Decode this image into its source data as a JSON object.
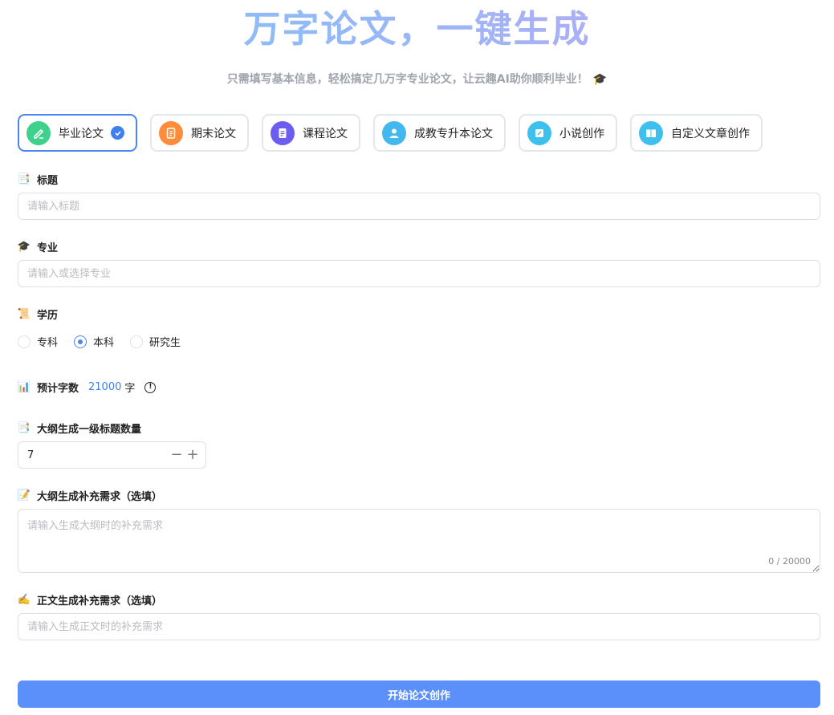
{
  "hero": {
    "title": "万字论文，一键生成",
    "subtitle": "只需填写基本信息，轻松搞定几万字专业论文，让云趣AI助你顺利毕业！",
    "subtitle_emoji": "🎓"
  },
  "paper_types": [
    {
      "label": "毕业论文",
      "icon": "pen-icon",
      "color": "#3fd08c",
      "active": true
    },
    {
      "label": "期末论文",
      "icon": "document-icon",
      "color": "#ff8c3b",
      "active": false
    },
    {
      "label": "课程论文",
      "icon": "notes-icon",
      "color": "#6c5cf0",
      "active": false
    },
    {
      "label": "成教专升本论文",
      "icon": "person-icon",
      "color": "#42b8ef",
      "active": false
    },
    {
      "label": "小说创作",
      "icon": "edit-icon",
      "color": "#3ec0ef",
      "active": false
    },
    {
      "label": "自定义文章创作",
      "icon": "book-icon",
      "color": "#3ec0ef",
      "active": false
    }
  ],
  "form": {
    "title": {
      "label": "标题",
      "placeholder": "请输入标题",
      "emoji": "📑"
    },
    "major": {
      "label": "专业",
      "placeholder": "请输入或选择专业",
      "emoji": "🎓"
    },
    "degree": {
      "label": "学历",
      "emoji": "📜",
      "options": [
        "专科",
        "本科",
        "研究生"
      ],
      "selected": "本科"
    },
    "word_count": {
      "label": "预计字数",
      "value": "21000",
      "unit": "字",
      "emoji": "📊",
      "info": "!"
    },
    "outline_count": {
      "label": "大纲生成一级标题数量",
      "value": "7",
      "emoji": "📑"
    },
    "outline_extra": {
      "label": "大纲生成补充需求（选填）",
      "placeholder": "请输入生成大纲时的补充需求",
      "counter": "0 / 20000",
      "emoji": "📝"
    },
    "body_extra": {
      "label": "正文生成补充需求（选填）",
      "placeholder": "请输入生成正文时的补充需求",
      "emoji": "✍️"
    }
  },
  "submit_label": "开始论文创作",
  "colors": {
    "accent": "#4a86f0",
    "submit": "#5b8ff9"
  }
}
